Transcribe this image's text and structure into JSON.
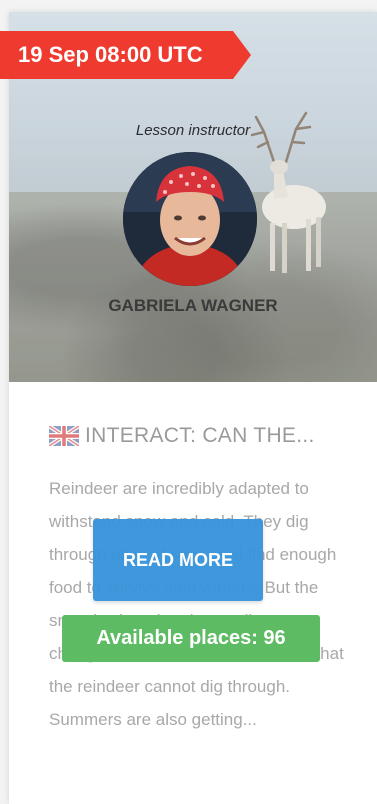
{
  "lesson": {
    "date_label": "19 Sep 08:00 UTC",
    "instructor_caption": "Lesson instructor",
    "instructor_name": "GABRIELA WAGNER",
    "title": "INTERACT: CAN THE...",
    "flag_icon": "uk-flag-icon",
    "description": "Reindeer are incredibly adapted to withstand snow and cold. They dig through piles of snow and find enough food to survive long winters. But the snow is changing due to climate change. It can form thick ice crusts that the reindeer cannot dig through. Summers are also getting...",
    "read_more_label": "READ MORE",
    "available_places": "Available places: 96"
  },
  "colors": {
    "ribbon": "#ef3b2f",
    "read_more": "#3a95db",
    "places": "#5dbb63"
  }
}
